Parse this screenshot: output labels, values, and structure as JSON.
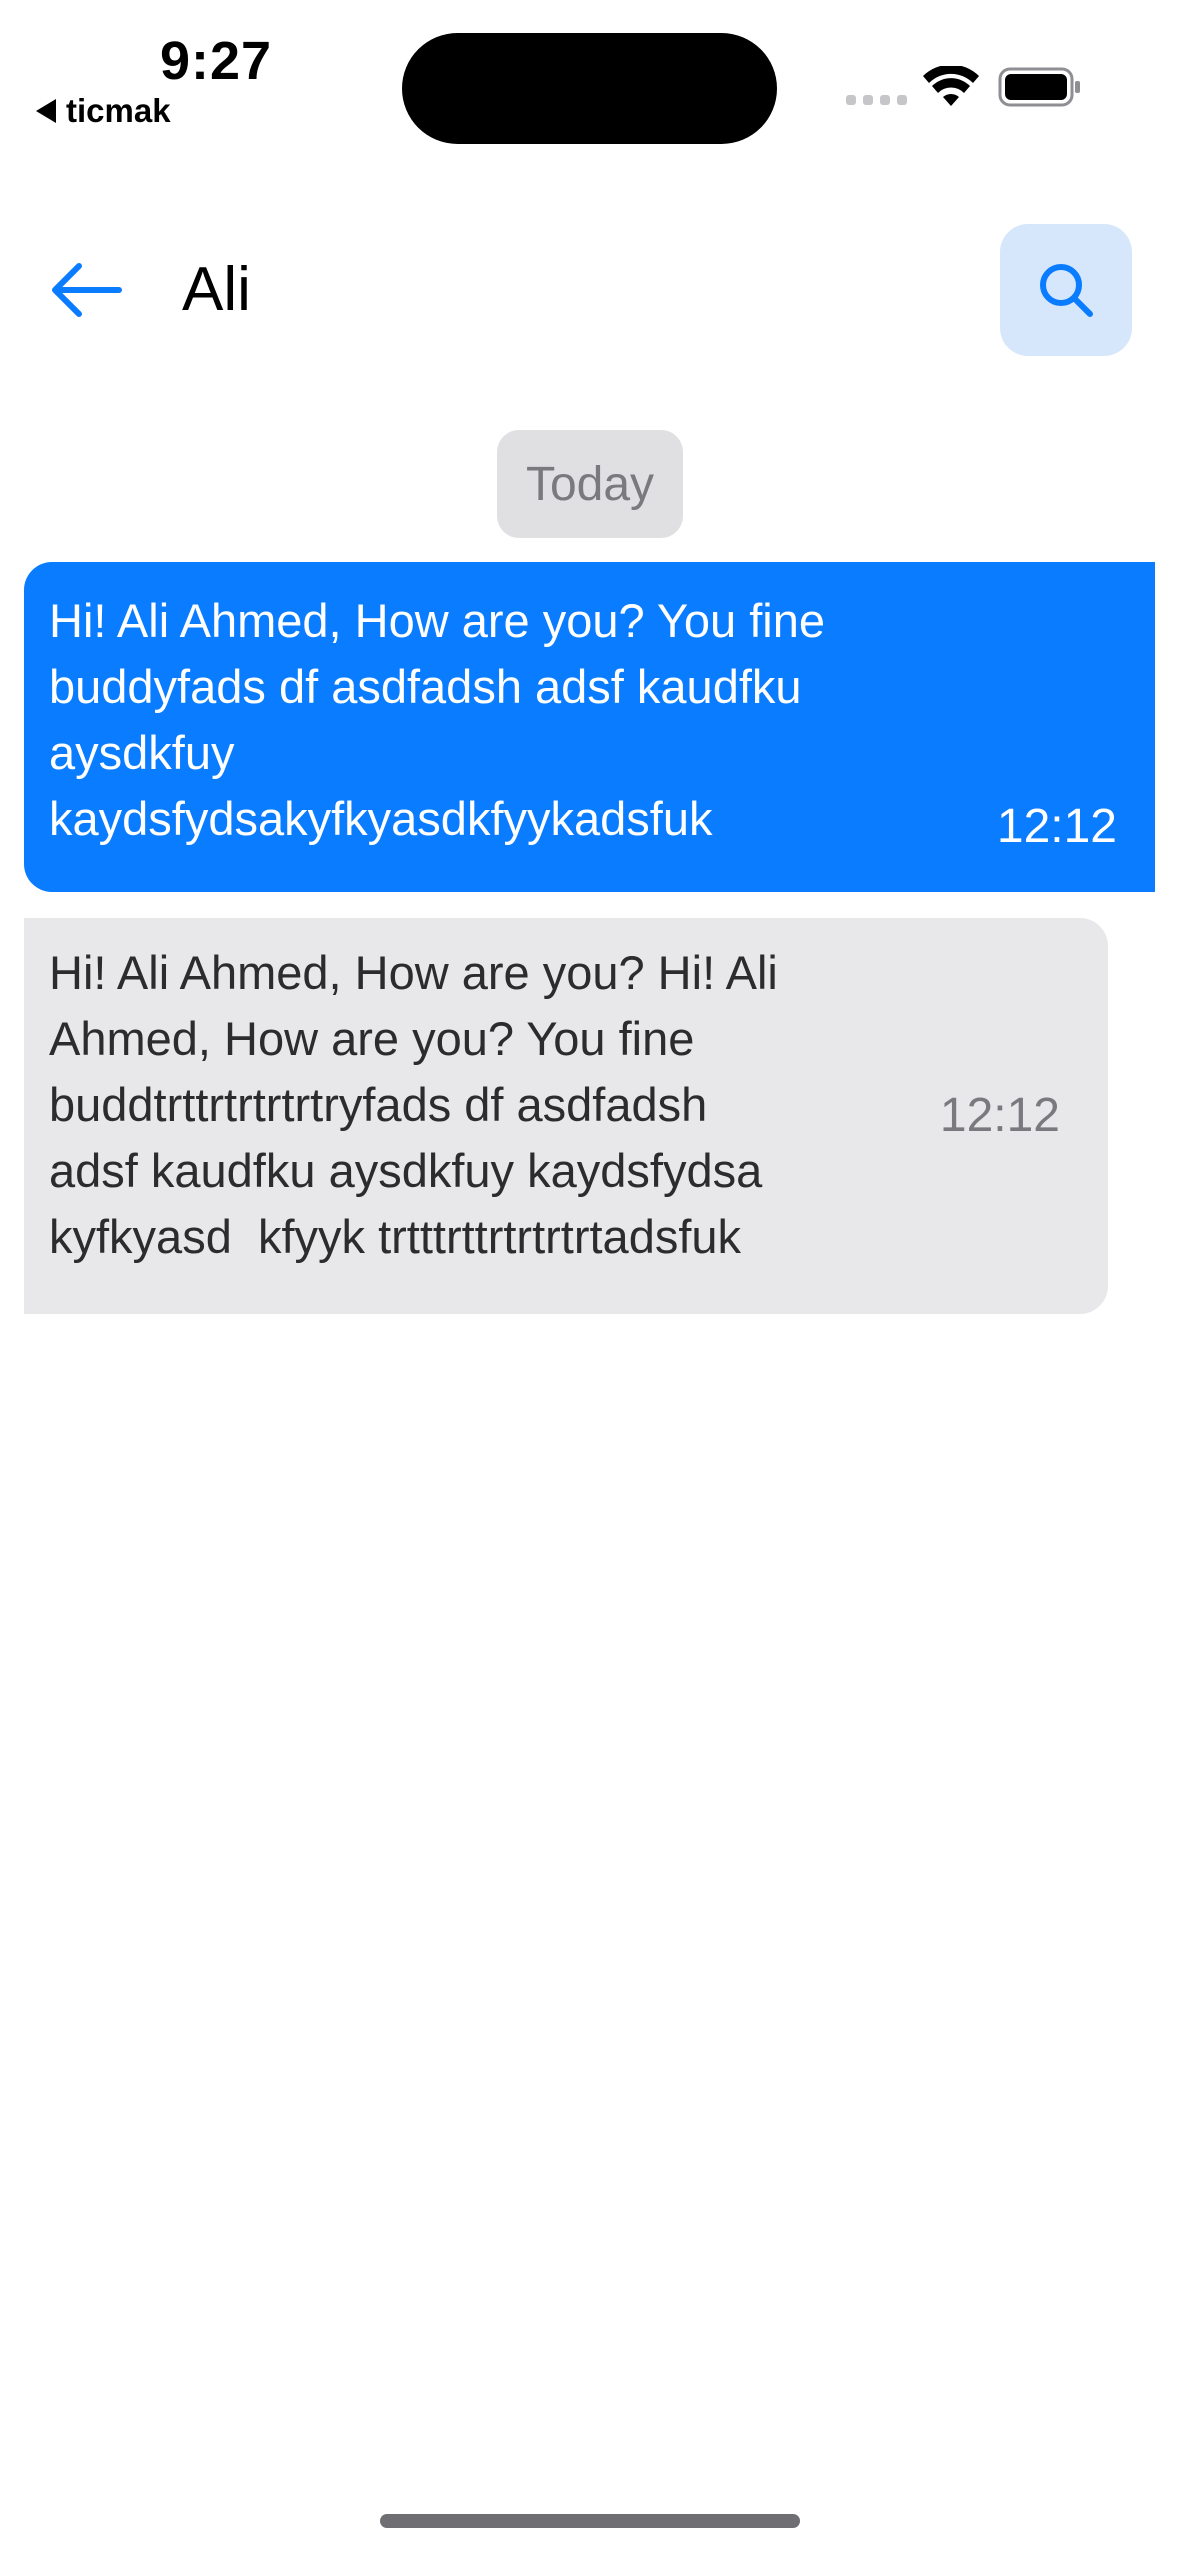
{
  "status_bar": {
    "time": "9:27",
    "back_app_label": "ticmak"
  },
  "header": {
    "contact_name": "Ali",
    "back_icon": "arrow-left-icon",
    "search_icon": "search-icon"
  },
  "chat": {
    "date_separator": "Today",
    "messages": [
      {
        "direction": "outgoing",
        "text": "Hi! Ali Ahmed, How are you? You fine\nbuddyfads df asdfadsh adsf kaudfku\naysdkfuy\nkaydsfydsakyfkyasdkfyykadsfuk",
        "time": "12:12"
      },
      {
        "direction": "incoming",
        "text": "Hi! Ali Ahmed, How are you? Hi! Ali\nAhmed, How are you? You fine\nbuddtrttrtrtrtrtryfads df asdfadsh\nadsf kaudfku aysdkfuy kaydsfydsa\nkyfkyasd  kfyyk trtttrttrtrtrtrtadsfuk",
        "time": "12:12"
      }
    ]
  },
  "colors": {
    "accent": "#0a7cff",
    "search_button_bg": "#d6e7fb",
    "incoming_bubble": "#e8e8ea",
    "date_pill": "#e0e0e2"
  }
}
